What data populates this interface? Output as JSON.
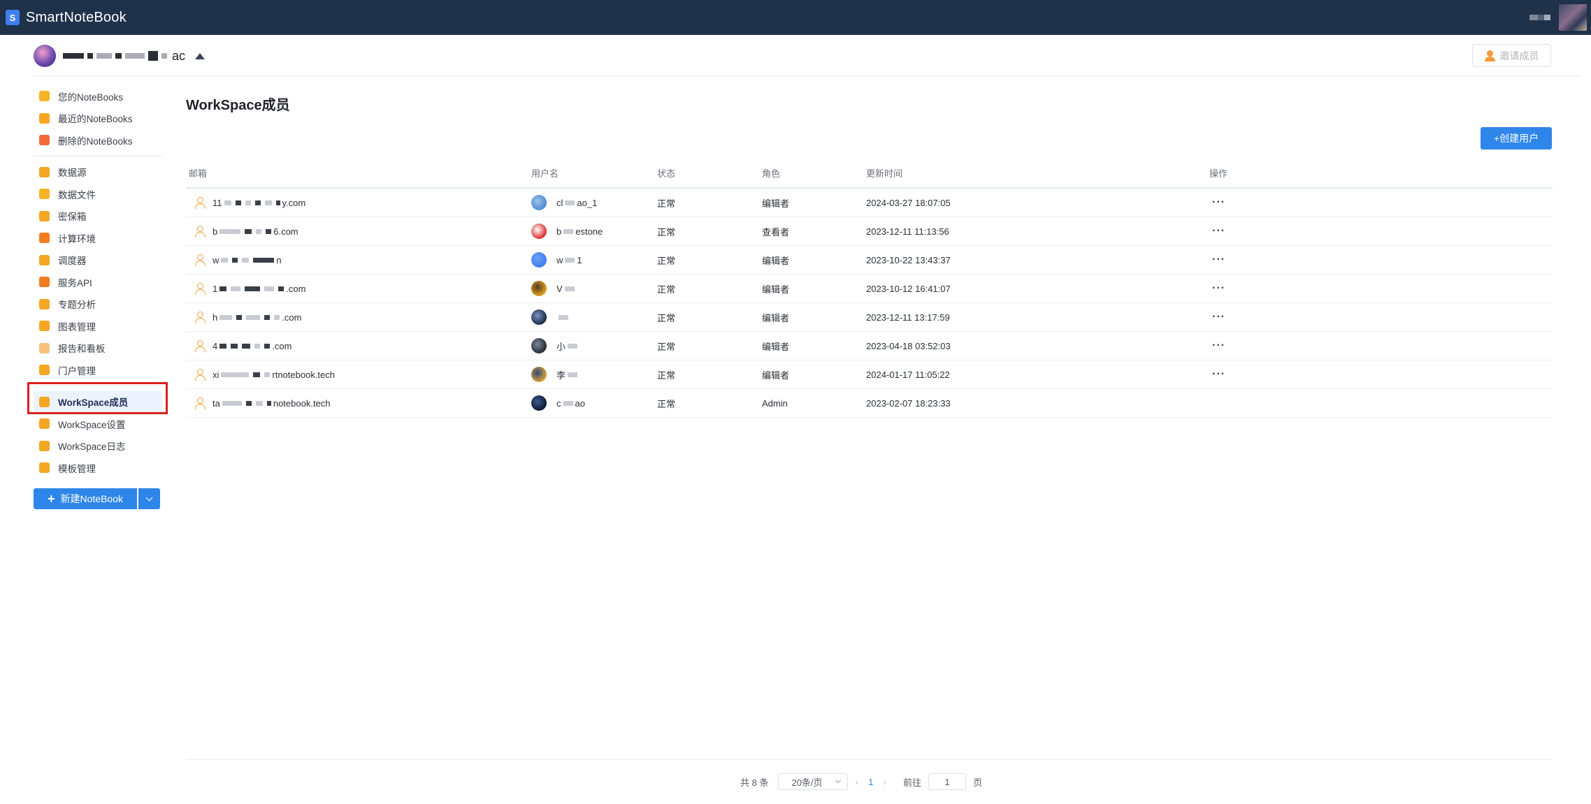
{
  "app": {
    "logo_letter": "S",
    "title": "SmartNoteBook"
  },
  "workspace": {
    "name_tail": "ac",
    "invite_label": "邀请成员"
  },
  "sidebar": {
    "group1": [
      {
        "label": "您的NoteBooks",
        "icon": "notebook-icon",
        "color": "#f5b325"
      },
      {
        "label": "最近的NoteBooks",
        "icon": "clock-icon",
        "color": "#f5a623"
      },
      {
        "label": "删除的NoteBooks",
        "icon": "trash-icon",
        "color": "#f26b3a"
      }
    ],
    "group2": [
      {
        "label": "数据源",
        "icon": "database-icon",
        "color": "#f5a623"
      },
      {
        "label": "数据文件",
        "icon": "folder-icon",
        "color": "#f5b325"
      },
      {
        "label": "密保箱",
        "icon": "shield-icon",
        "color": "#f5a623"
      },
      {
        "label": "计算环境",
        "icon": "dropbox-icon",
        "color": "#f27c1f"
      },
      {
        "label": "调度器",
        "icon": "scheduler-icon",
        "color": "#f5a623"
      },
      {
        "label": "服务API",
        "icon": "function-icon",
        "color": "#f27c1f"
      },
      {
        "label": "专题分析",
        "icon": "analysis-icon",
        "color": "#f5a623"
      },
      {
        "label": "图表管理",
        "icon": "chart-icon",
        "color": "#f5a623"
      },
      {
        "label": "报告和看板",
        "icon": "report-icon",
        "color": "#f5c27a"
      },
      {
        "label": "门户管理",
        "icon": "monitor-icon",
        "color": "#f5a623"
      }
    ],
    "group3": [
      {
        "label": "WorkSpace成员",
        "icon": "members-icon",
        "color": "#f5a623",
        "active": true
      },
      {
        "label": "WorkSpace设置",
        "icon": "settings-icon",
        "color": "#f5a623"
      },
      {
        "label": "WorkSpace日志",
        "icon": "log-icon",
        "color": "#f5a623"
      },
      {
        "label": "模板管理",
        "icon": "template-icon",
        "color": "#f5a623"
      }
    ],
    "new_notebook_label": "新建NoteBook"
  },
  "main": {
    "title": "WorkSpace成员",
    "create_user_label": "+创建用户",
    "columns": [
      "邮箱",
      "用户名",
      "状态",
      "角色",
      "更新时间",
      "操作"
    ],
    "rows": [
      {
        "email_start": "11",
        "email_end": "y.com",
        "user_start": "cl",
        "user_end": "ao_1",
        "status": "正常",
        "role": "编辑者",
        "updated": "2024-03-27 18:07:05",
        "has_ops": true,
        "avatar": [
          "#4d8bd6",
          "#9cc2e8"
        ]
      },
      {
        "email_start": "b",
        "email_end": "6.com",
        "user_start": "b",
        "user_end": "estone",
        "status": "正常",
        "role": "查看者",
        "updated": "2023-12-11 11:13:56",
        "has_ops": true,
        "avatar": [
          "#d92c2c",
          "#ffffff"
        ]
      },
      {
        "email_start": "w",
        "email_end": "n",
        "user_start": "w",
        "user_end": "1",
        "status": "正常",
        "role": "编辑者",
        "updated": "2023-10-22 13:43:37",
        "has_ops": true,
        "avatar": [
          "#3f7ef0",
          "#6aa1f5"
        ]
      },
      {
        "email_start": "1",
        "email_end": ".com",
        "user_start": "V",
        "user_end": "",
        "status": "正常",
        "role": "编辑者",
        "updated": "2023-10-12 16:41:07",
        "has_ops": true,
        "avatar": [
          "#e0a020",
          "#5a3a22"
        ]
      },
      {
        "email_start": "h",
        "email_end": ".com",
        "user_start": "",
        "user_end": "",
        "status": "正常",
        "role": "编辑者",
        "updated": "2023-12-11 13:17:59",
        "has_ops": true,
        "avatar": [
          "#1c2a48",
          "#7a92c0"
        ]
      },
      {
        "email_start": "4",
        "email_end": ".com",
        "user_start": "小",
        "user_end": "",
        "status": "正常",
        "role": "编辑者",
        "updated": "2023-04-18 03:52:03",
        "has_ops": true,
        "avatar": [
          "#262c35",
          "#7c8796"
        ]
      },
      {
        "email_start": "xi",
        "email_end": "rtnotebook.tech",
        "user_start": "李",
        "user_end": "",
        "status": "正常",
        "role": "编辑者",
        "updated": "2024-01-17 11:05:22",
        "has_ops": true,
        "avatar": [
          "#d5a33a",
          "#2f4a7a"
        ]
      },
      {
        "email_start": "ta",
        "email_end": "notebook.tech",
        "user_start": "c",
        "user_end": "ao",
        "status": "正常",
        "role": "Admin",
        "updated": "2023-02-07 18:23:33",
        "has_ops": false,
        "avatar": [
          "#0f1a33",
          "#3a5890"
        ]
      }
    ],
    "ops_label": "···"
  },
  "pagination": {
    "total_label": "共 8 条",
    "page_size_label": "20条/页",
    "current_page": "1",
    "goto_label": "前往",
    "goto_value": "1",
    "page_unit": "页"
  }
}
